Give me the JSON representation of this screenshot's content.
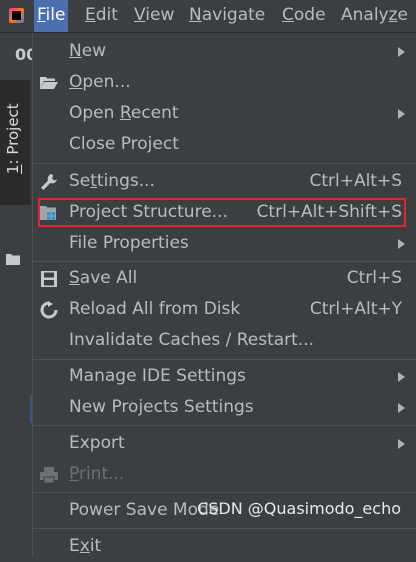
{
  "menubar": {
    "items": [
      {
        "pre": "",
        "mn": "F",
        "post": "ile"
      },
      {
        "pre": "",
        "mn": "E",
        "post": "dit"
      },
      {
        "pre": "",
        "mn": "V",
        "post": "iew"
      },
      {
        "pre": "",
        "mn": "N",
        "post": "avigate"
      },
      {
        "pre": "",
        "mn": "C",
        "post": "ode"
      },
      {
        "pre": "Analy",
        "mn": "z",
        "post": "e"
      }
    ]
  },
  "background": {
    "truncated_text": "00",
    "project_tab": {
      "mn": "1",
      "rest": ": Project"
    }
  },
  "file_menu": {
    "items": [
      {
        "pre": "",
        "mn": "N",
        "post": "ew",
        "shortcut": "",
        "submenu": true
      },
      {
        "pre": "",
        "mn": "O",
        "post": "pen...",
        "shortcut": "",
        "submenu": false
      },
      {
        "pre": "Open ",
        "mn": "R",
        "post": "ecent",
        "shortcut": "",
        "submenu": true
      },
      {
        "pre": "Close Project",
        "mn": "",
        "post": "",
        "shortcut": "",
        "submenu": false
      },
      {
        "pre": "Se",
        "mn": "t",
        "post": "tings...",
        "shortcut": "Ctrl+Alt+S",
        "submenu": false
      },
      {
        "pre": "Project Structure...",
        "mn": "",
        "post": "",
        "shortcut": "Ctrl+Alt+Shift+S",
        "submenu": false
      },
      {
        "pre": "File Properties",
        "mn": "",
        "post": "",
        "shortcut": "",
        "submenu": true
      },
      {
        "pre": "",
        "mn": "S",
        "post": "ave All",
        "shortcut": "Ctrl+S",
        "submenu": false
      },
      {
        "pre": "Reload All from Disk",
        "mn": "",
        "post": "",
        "shortcut": "Ctrl+Alt+Y",
        "submenu": false
      },
      {
        "pre": "Invalidate Caches / Restart...",
        "mn": "",
        "post": "",
        "shortcut": "",
        "submenu": false
      },
      {
        "pre": "Manage IDE Settings",
        "mn": "",
        "post": "",
        "shortcut": "",
        "submenu": true
      },
      {
        "pre": "New Projects Settings",
        "mn": "",
        "post": "",
        "shortcut": "",
        "submenu": true
      },
      {
        "pre": "Export",
        "mn": "",
        "post": "",
        "shortcut": "",
        "submenu": true
      },
      {
        "pre": "",
        "mn": "P",
        "post": "rint...",
        "shortcut": "",
        "submenu": false,
        "disabled": true
      },
      {
        "pre": "Power Save Mode",
        "mn": "",
        "post": "",
        "shortcut": "",
        "submenu": false
      },
      {
        "pre": "E",
        "mn": "x",
        "post": "it",
        "shortcut": "",
        "submenu": false
      }
    ]
  },
  "watermark": "CSDN @Quasimodo_echo",
  "colors": {
    "menu_bg": "#3c3f41",
    "selected_menu": "#4b6eaf",
    "highlight_border": "#e0262f"
  }
}
